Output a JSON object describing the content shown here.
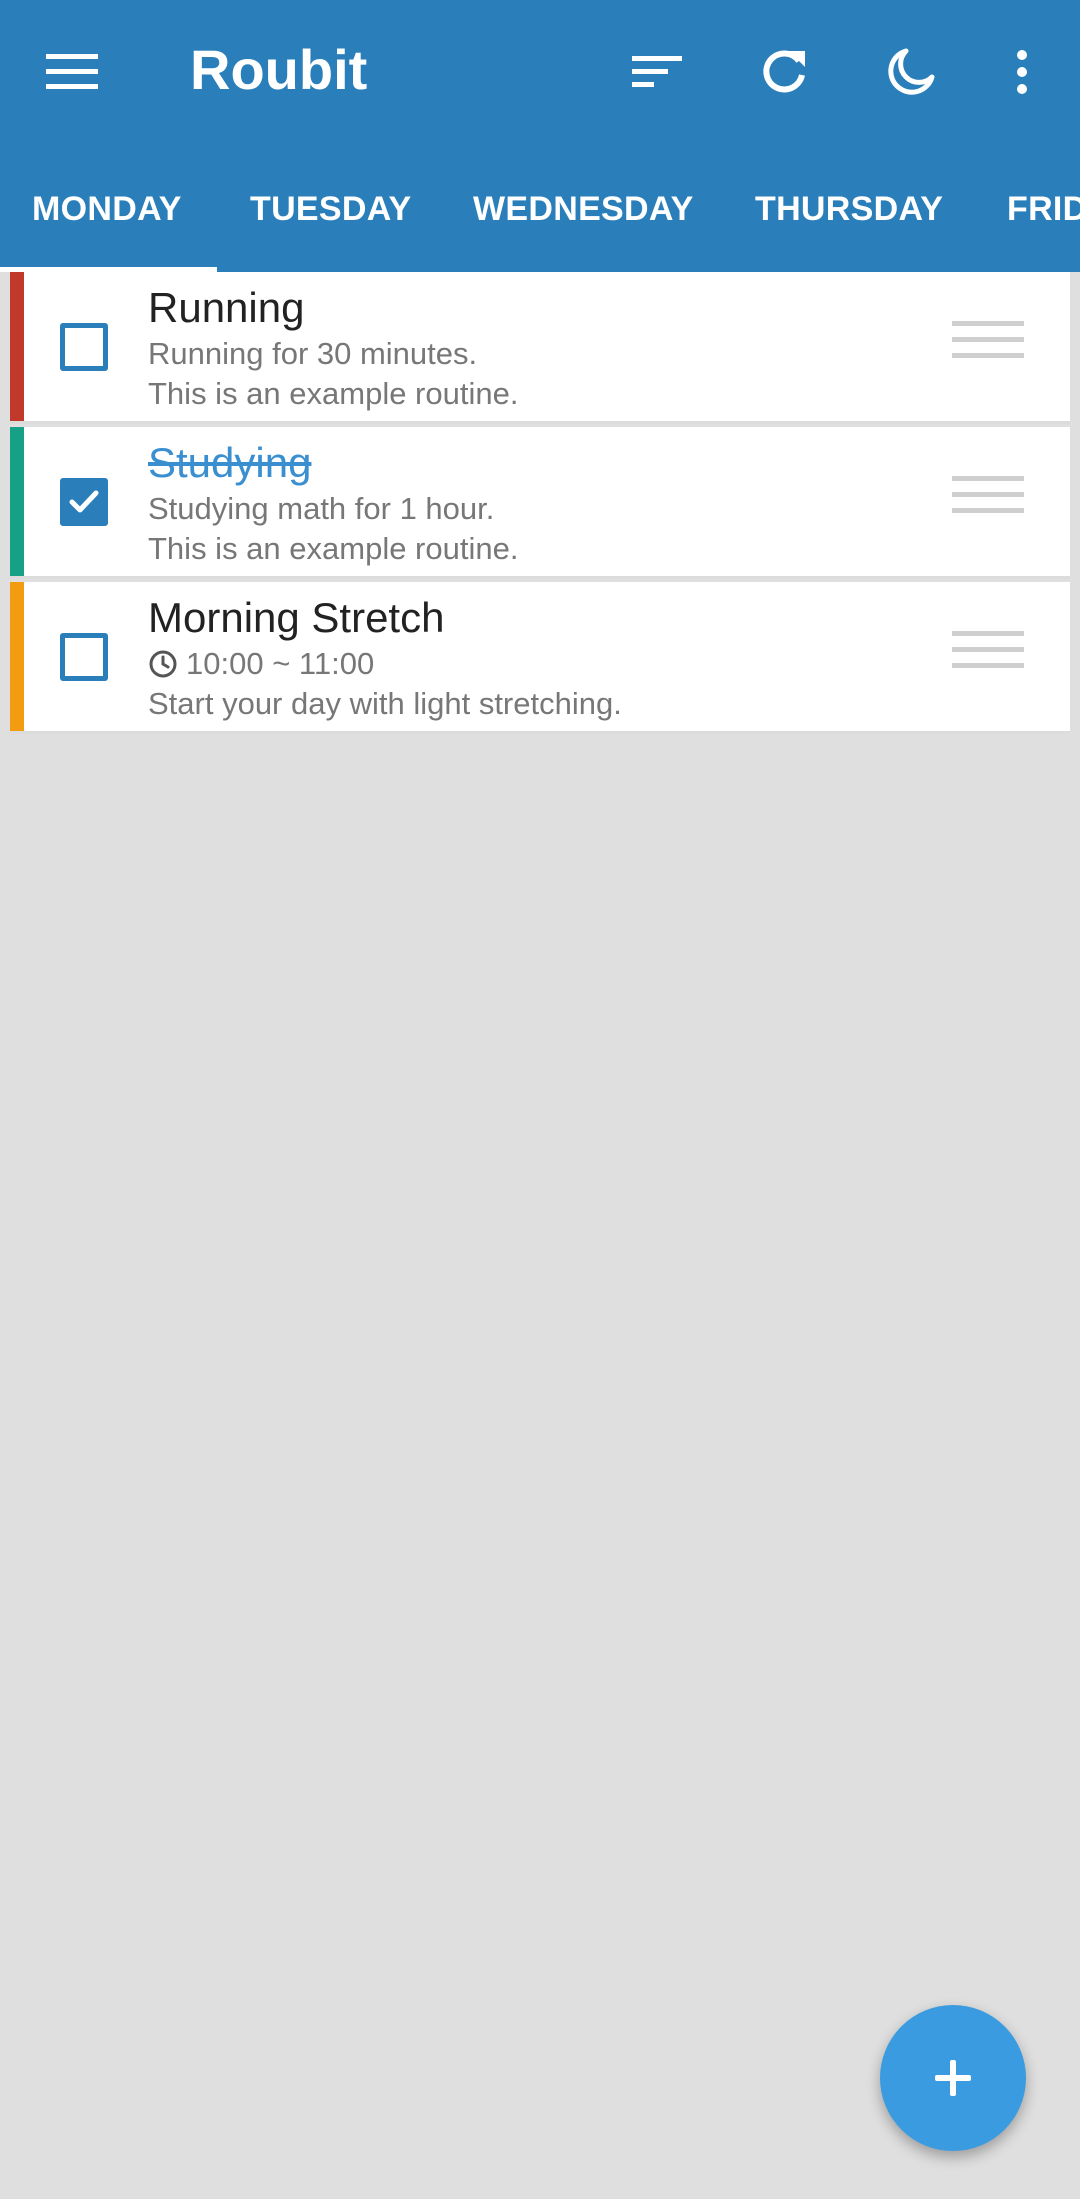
{
  "app": {
    "title": "Roubit"
  },
  "colors": {
    "appbar": "#2a7fba",
    "accent": "#3a9be0",
    "background": "#dfdfdf"
  },
  "toolbar": {
    "menu_icon": "hamburger-menu-icon",
    "sort_icon": "sort-icon",
    "refresh_icon": "refresh-icon",
    "night_icon": "moon-icon",
    "more_icon": "more-vertical-icon"
  },
  "tabs": [
    {
      "label": "MONDAY",
      "selected": true
    },
    {
      "label": "TUESDAY"
    },
    {
      "label": "WEDNESDAY"
    },
    {
      "label": "THURSDAY"
    },
    {
      "label": "FRID"
    }
  ],
  "routines": [
    {
      "title": "Running",
      "checked": false,
      "color": "#c0392b",
      "lines": [
        "Running for 30 minutes.",
        "This is an example routine."
      ]
    },
    {
      "title": "Studying",
      "checked": true,
      "color": "#16a085",
      "lines": [
        "Studying math for 1 hour.",
        "This is an example routine."
      ]
    },
    {
      "title": "Morning Stretch",
      "checked": false,
      "color": "#f39c12",
      "time": "10:00 ~ 11:00",
      "lines": [
        "Start your day with light stretching."
      ]
    }
  ],
  "fab": {
    "icon": "plus-icon"
  }
}
